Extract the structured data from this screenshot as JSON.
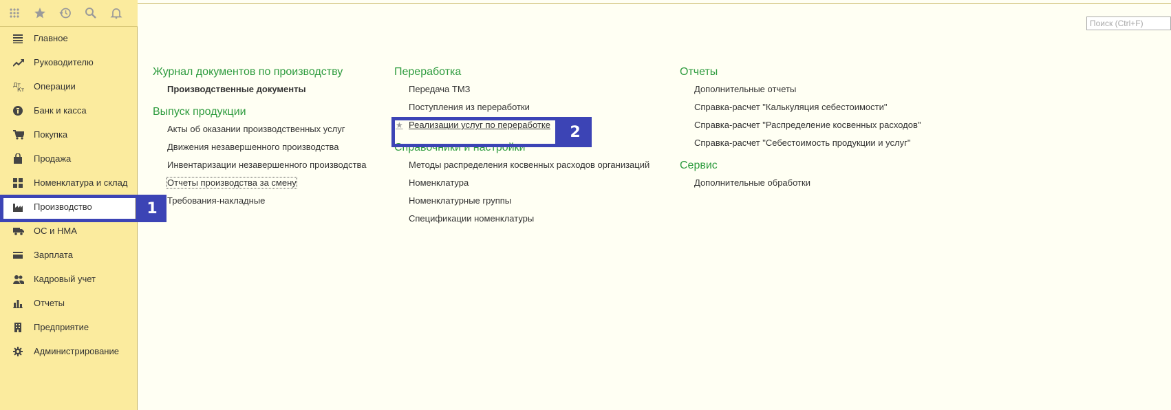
{
  "toolbar": {
    "icons": [
      "apps-grid-icon",
      "star-icon",
      "history-icon",
      "search-icon",
      "bell-icon"
    ]
  },
  "sidebar": {
    "items": [
      {
        "label": "Главное",
        "icon": "menu-lines-icon"
      },
      {
        "label": "Руководителю",
        "icon": "trend-icon"
      },
      {
        "label": "Операции",
        "icon": "dt-kt-icon"
      },
      {
        "label": "Банк и касса",
        "icon": "bank-icon"
      },
      {
        "label": "Покупка",
        "icon": "cart-icon"
      },
      {
        "label": "Продажа",
        "icon": "bag-icon"
      },
      {
        "label": "Номенклатура и склад",
        "icon": "grid-icon"
      },
      {
        "label": "Производство",
        "icon": "factory-icon",
        "active": true
      },
      {
        "label": "ОС и НМА",
        "icon": "truck-icon"
      },
      {
        "label": "Зарплата",
        "icon": "wallet-icon"
      },
      {
        "label": "Кадровый учет",
        "icon": "people-icon"
      },
      {
        "label": "Отчеты",
        "icon": "bar-chart-icon"
      },
      {
        "label": "Предприятие",
        "icon": "building-icon"
      },
      {
        "label": "Администрирование",
        "icon": "gear-icon"
      }
    ]
  },
  "search": {
    "placeholder": "Поиск (Ctrl+F)"
  },
  "callouts": {
    "one": "1",
    "two": "2"
  },
  "columns": {
    "col1": {
      "sections": [
        {
          "title": "Журнал документов по производству",
          "links": [
            "Производственные документы"
          ]
        },
        {
          "title": "Выпуск продукции",
          "links": [
            "Акты об оказании производственных услуг",
            "Движения незавершенного производства",
            "Инвентаризации незавершенного производства",
            "Отчеты производства за смену",
            "Требования-накладные"
          ]
        }
      ]
    },
    "col2": {
      "sections": [
        {
          "title": "Переработка",
          "links": [
            "Передача ТМЗ",
            "Поступления из переработки",
            "Реализации услуг по переработке"
          ]
        },
        {
          "title": "Справочники и настройки",
          "links": [
            "Методы распределения косвенных расходов организаций",
            "Номенклатура",
            "Номенклатурные группы",
            "Спецификации номенклатуры"
          ]
        }
      ]
    },
    "col3": {
      "sections": [
        {
          "title": "Отчеты",
          "links": [
            "Дополнительные отчеты",
            "Справка-расчет \"Калькуляция себестоимости\"",
            "Справка-расчет \"Распределение косвенных расходов\"",
            "Справка-расчет \"Себестоимость продукции и услуг\""
          ]
        },
        {
          "title": "Сервис",
          "links": [
            "Дополнительные обработки"
          ]
        }
      ]
    }
  },
  "colors": {
    "accent_green": "#2d9b3e",
    "sidebar_bg": "#fbeb9e",
    "callout_blue": "#3c44b5"
  }
}
